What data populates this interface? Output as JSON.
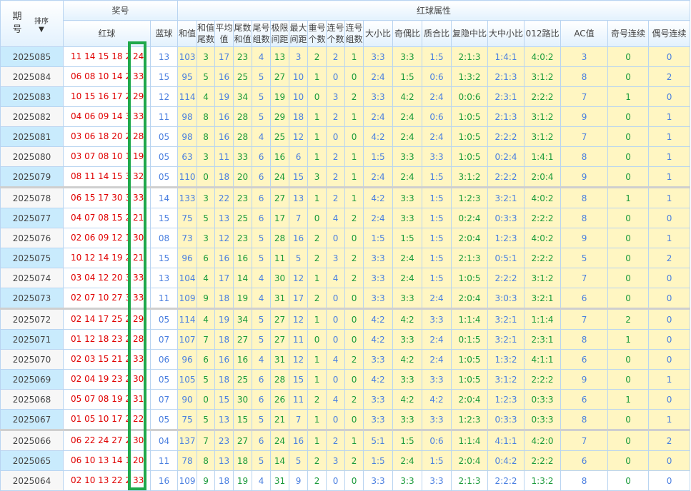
{
  "header": {
    "period": "期号",
    "sort_label": "排序",
    "sort_icon": "arrow-down-icon",
    "draw_group": "奖号",
    "red_ball": "红球",
    "blue_ball": "蓝球",
    "attr_group": "红球属性",
    "attrs": [
      "和值",
      "和值尾数",
      "平均值",
      "尾数和值",
      "尾号组数",
      "极限间距",
      "最大间距",
      "重号个数",
      "连号个数",
      "连号组数",
      "大小比",
      "奇偶比",
      "质合比",
      "复隐中比",
      "大中小比",
      "012路比",
      "AC值",
      "奇号连续",
      "偶号连续"
    ]
  },
  "rows": [
    [
      "2025085",
      "11 14 15 18 21",
      "24",
      "13",
      "103",
      "3",
      "17",
      "23",
      "4",
      "13",
      "3",
      "2",
      "2",
      "1",
      "3:3",
      "3:3",
      "1:5",
      "2:1:3",
      "1:4:1",
      "4:0:2",
      "3",
      "0",
      "0"
    ],
    [
      "2025084",
      "06 08 10 14 24",
      "33",
      "15",
      "95",
      "5",
      "16",
      "25",
      "5",
      "27",
      "10",
      "1",
      "0",
      "0",
      "2:4",
      "1:5",
      "0:6",
      "1:3:2",
      "2:1:3",
      "3:1:2",
      "8",
      "0",
      "2"
    ],
    [
      "2025083",
      "10 15 16 17 27",
      "29",
      "12",
      "114",
      "4",
      "19",
      "34",
      "5",
      "19",
      "10",
      "0",
      "3",
      "2",
      "3:3",
      "4:2",
      "2:4",
      "0:0:6",
      "2:3:1",
      "2:2:2",
      "7",
      "1",
      "0"
    ],
    [
      "2025082",
      "04 06 09 14 32",
      "33",
      "11",
      "98",
      "8",
      "16",
      "28",
      "5",
      "29",
      "18",
      "1",
      "2",
      "1",
      "2:4",
      "2:4",
      "0:6",
      "1:0:5",
      "2:1:3",
      "3:1:2",
      "9",
      "0",
      "1"
    ],
    [
      "2025081",
      "03 06 18 20 23",
      "28",
      "05",
      "98",
      "8",
      "16",
      "28",
      "4",
      "25",
      "12",
      "1",
      "0",
      "0",
      "4:2",
      "2:4",
      "2:4",
      "1:0:5",
      "2:2:2",
      "3:1:2",
      "7",
      "0",
      "1"
    ],
    [
      "2025080",
      "03 07 08 10 16",
      "19",
      "05",
      "63",
      "3",
      "11",
      "33",
      "6",
      "16",
      "6",
      "1",
      "2",
      "1",
      "1:5",
      "3:3",
      "3:3",
      "1:0:5",
      "0:2:4",
      "1:4:1",
      "8",
      "0",
      "1"
    ],
    [
      "2025079",
      "08 11 14 15 30",
      "32",
      "05",
      "110",
      "0",
      "18",
      "20",
      "6",
      "24",
      "15",
      "3",
      "2",
      "1",
      "2:4",
      "2:4",
      "1:5",
      "3:1:2",
      "2:2:2",
      "2:0:4",
      "9",
      "0",
      "1"
    ],
    [
      "2025078",
      "06 15 17 30 32",
      "33",
      "14",
      "133",
      "3",
      "22",
      "23",
      "6",
      "27",
      "13",
      "1",
      "2",
      "1",
      "4:2",
      "3:3",
      "1:5",
      "1:2:3",
      "3:2:1",
      "4:0:2",
      "8",
      "1",
      "1"
    ],
    [
      "2025077",
      "04 07 08 15 20",
      "21",
      "15",
      "75",
      "5",
      "13",
      "25",
      "6",
      "17",
      "7",
      "0",
      "4",
      "2",
      "2:4",
      "3:3",
      "1:5",
      "0:2:4",
      "0:3:3",
      "2:2:2",
      "8",
      "0",
      "0"
    ],
    [
      "2025076",
      "02 06 09 12 14",
      "30",
      "08",
      "73",
      "3",
      "12",
      "23",
      "5",
      "28",
      "16",
      "2",
      "0",
      "0",
      "1:5",
      "1:5",
      "1:5",
      "2:0:4",
      "1:2:3",
      "4:0:2",
      "9",
      "0",
      "1"
    ],
    [
      "2025075",
      "10 12 14 19 20",
      "21",
      "15",
      "96",
      "6",
      "16",
      "16",
      "5",
      "11",
      "5",
      "2",
      "3",
      "2",
      "3:3",
      "2:4",
      "1:5",
      "2:1:3",
      "0:5:1",
      "2:2:2",
      "5",
      "0",
      "2"
    ],
    [
      "2025074",
      "03 04 12 20 32",
      "33",
      "13",
      "104",
      "4",
      "17",
      "14",
      "4",
      "30",
      "12",
      "1",
      "4",
      "2",
      "3:3",
      "2:4",
      "1:5",
      "1:0:5",
      "2:2:2",
      "3:1:2",
      "7",
      "0",
      "0"
    ],
    [
      "2025073",
      "02 07 10 27 30",
      "33",
      "11",
      "109",
      "9",
      "18",
      "19",
      "4",
      "31",
      "17",
      "2",
      "0",
      "0",
      "3:3",
      "3:3",
      "2:4",
      "2:0:4",
      "3:0:3",
      "3:2:1",
      "6",
      "0",
      "0"
    ],
    [
      "2025072",
      "02 14 17 25 27",
      "29",
      "05",
      "114",
      "4",
      "19",
      "34",
      "5",
      "27",
      "12",
      "1",
      "0",
      "0",
      "4:2",
      "4:2",
      "3:3",
      "1:1:4",
      "3:2:1",
      "1:1:4",
      "7",
      "2",
      "0"
    ],
    [
      "2025071",
      "01 12 18 23 25",
      "28",
      "07",
      "107",
      "7",
      "18",
      "27",
      "5",
      "27",
      "11",
      "0",
      "0",
      "0",
      "4:2",
      "3:3",
      "2:4",
      "0:1:5",
      "3:2:1",
      "2:3:1",
      "8",
      "1",
      "0"
    ],
    [
      "2025070",
      "02 03 15 21 22",
      "33",
      "06",
      "96",
      "6",
      "16",
      "16",
      "4",
      "31",
      "12",
      "1",
      "4",
      "2",
      "3:3",
      "4:2",
      "2:4",
      "1:0:5",
      "1:3:2",
      "4:1:1",
      "6",
      "0",
      "0"
    ],
    [
      "2025069",
      "02 04 19 23 27",
      "30",
      "05",
      "105",
      "5",
      "18",
      "25",
      "6",
      "28",
      "15",
      "1",
      "0",
      "0",
      "4:2",
      "3:3",
      "3:3",
      "1:0:5",
      "3:1:2",
      "2:2:2",
      "9",
      "0",
      "1"
    ],
    [
      "2025068",
      "05 07 08 19 20",
      "31",
      "07",
      "90",
      "0",
      "15",
      "30",
      "6",
      "26",
      "11",
      "2",
      "4",
      "2",
      "3:3",
      "4:2",
      "4:2",
      "2:0:4",
      "1:2:3",
      "0:3:3",
      "6",
      "1",
      "0"
    ],
    [
      "2025067",
      "01 05 10 17 20",
      "22",
      "05",
      "75",
      "5",
      "13",
      "15",
      "5",
      "21",
      "7",
      "1",
      "0",
      "0",
      "3:3",
      "3:3",
      "3:3",
      "1:2:3",
      "0:3:3",
      "0:3:3",
      "8",
      "0",
      "1"
    ],
    [
      "2025066",
      "06 22 24 27 28",
      "30",
      "04",
      "137",
      "7",
      "23",
      "27",
      "6",
      "24",
      "16",
      "1",
      "2",
      "1",
      "5:1",
      "1:5",
      "0:6",
      "1:1:4",
      "4:1:1",
      "4:2:0",
      "7",
      "0",
      "2"
    ],
    [
      "2025065",
      "06 10 13 14 15",
      "20",
      "11",
      "78",
      "8",
      "13",
      "18",
      "5",
      "14",
      "5",
      "2",
      "3",
      "2",
      "1:5",
      "2:4",
      "1:5",
      "2:0:4",
      "0:4:2",
      "2:2:2",
      "6",
      "0",
      "0"
    ],
    [
      "2025064",
      "02 10 13 22 29",
      "33",
      "16",
      "109",
      "9",
      "18",
      "19",
      "4",
      "31",
      "9",
      "2",
      "0",
      "0",
      "3:3",
      "3:3",
      "3:3",
      "2:1:3",
      "2:2:2",
      "1:3:2",
      "8",
      "0",
      "0"
    ]
  ],
  "colors": {
    "highlight_box": "#1fa84a",
    "red": "#e00000",
    "blue": "#4a7fe0",
    "green": "#1a9a3a",
    "attr_bg": "#fff6c2"
  }
}
